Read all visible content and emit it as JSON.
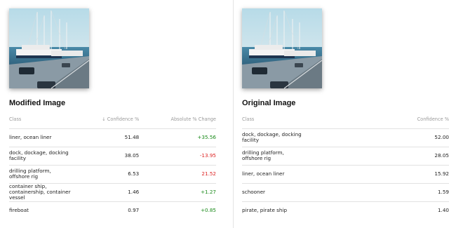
{
  "modified": {
    "title": "Modified Image",
    "headers": {
      "class": "Class",
      "confidence": "↓ Confidence %",
      "change": "Absolute % Change"
    },
    "rows": [
      {
        "label": "liner, ocean liner",
        "confidence": "51.48",
        "change": "+35.56",
        "direction": "positive"
      },
      {
        "label": "dock, dockage, docking facility",
        "confidence": "38.05",
        "change": "-13.95",
        "direction": "negative"
      },
      {
        "label": "drilling platform, offshore rig",
        "confidence": "6.53",
        "change": "21.52",
        "direction": "negative"
      },
      {
        "label": "container ship, containership, container vessel",
        "confidence": "1.46",
        "change": "+1.27",
        "direction": "positive"
      },
      {
        "label": "fireboat",
        "confidence": "0.97",
        "change": "+0.85",
        "direction": "positive"
      }
    ]
  },
  "original": {
    "title": "Original Image",
    "headers": {
      "class": "Class",
      "confidence": "Confidence %"
    },
    "rows": [
      {
        "label": "dock, dockage, docking facility",
        "confidence": "52.00"
      },
      {
        "label": "drilling platform, offshore rig",
        "confidence": "28.05"
      },
      {
        "label": "liner, ocean liner",
        "confidence": "15.92"
      },
      {
        "label": "schooner",
        "confidence": "1.59"
      },
      {
        "label": "pirate, pirate ship",
        "confidence": "1.40"
      }
    ]
  },
  "colors": {
    "positive": "#1a8a1a",
    "negative": "#dd2222"
  },
  "images": {
    "modified": "harbor-photo",
    "original": "harbor-photo"
  }
}
